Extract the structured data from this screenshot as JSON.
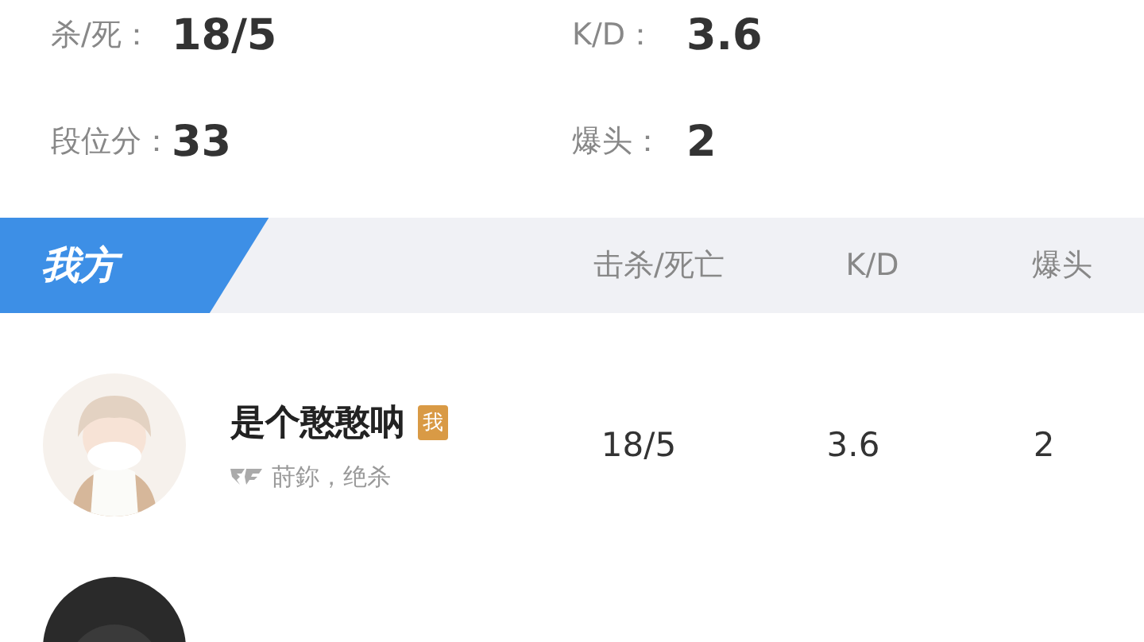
{
  "stats": [
    {
      "label": "杀/死：",
      "value": "18/5"
    },
    {
      "label": "K/D：",
      "value": "3.6"
    },
    {
      "label": "段位分：",
      "value": "33"
    },
    {
      "label": "爆头：",
      "value": "2"
    }
  ],
  "team": {
    "title": "我方",
    "columns": [
      "击杀/死亡",
      "K/D",
      "爆头"
    ]
  },
  "players": [
    {
      "kind": "full",
      "name": "是个憨憨呐",
      "badge": "我",
      "subtitle": "莳鉨，绝杀",
      "cells": [
        "18/5",
        "3.6",
        "2"
      ]
    },
    {
      "kind": "avatar_only"
    }
  ]
}
